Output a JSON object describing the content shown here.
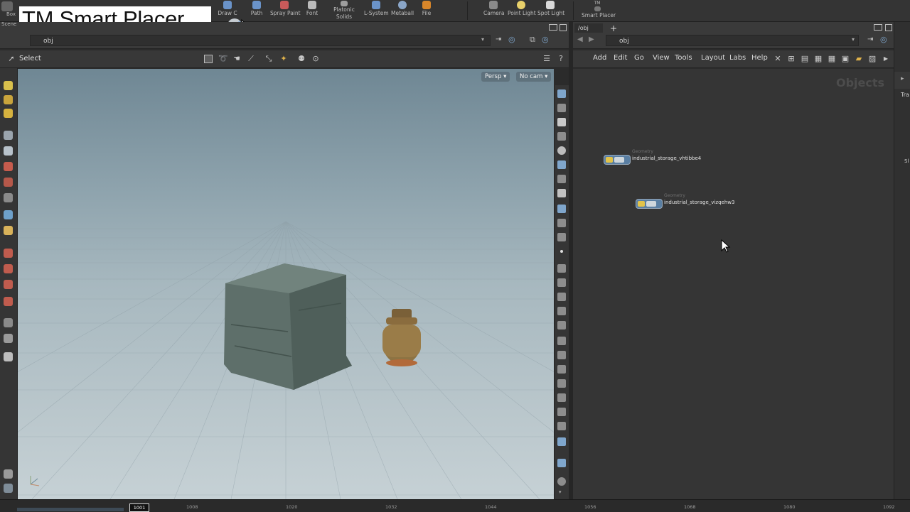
{
  "overlay_title": "TM Smart Placer",
  "shelf": {
    "left_cut": [
      "Box",
      "Scene"
    ],
    "tools": [
      {
        "label": "Draw Curve",
        "display": "Draw C",
        "icon": "draw-curve-icon"
      },
      {
        "label": "Path",
        "icon": "path-icon"
      },
      {
        "label": "Spray Paint",
        "icon": "spray-paint-icon"
      },
      {
        "label": "Font",
        "icon": "font-icon"
      },
      {
        "label": "Platonic Solids",
        "line1": "Platonic",
        "line2": "Solids",
        "icon": "platonic-solids-icon"
      },
      {
        "label": "L-System",
        "icon": "l-system-icon"
      },
      {
        "label": "Metaball",
        "icon": "metaball-icon"
      },
      {
        "label": "File",
        "icon": "file-icon"
      },
      {
        "label": "Camera",
        "icon": "camera-icon"
      },
      {
        "label": "Point Light",
        "icon": "point-light-icon"
      },
      {
        "label": "Spot Light",
        "icon": "spot-light-icon"
      },
      {
        "label": "Smart Placer",
        "top": "TM",
        "icon": "smart-placer-icon"
      }
    ]
  },
  "left_pane": {
    "path": "obj",
    "select_label": "Select",
    "persp_label": "Persp",
    "cam_label": "No cam"
  },
  "right_pane": {
    "tab": "/obj",
    "path": "obj",
    "menu": [
      "Add",
      "Edit",
      "Go",
      "View",
      "Tools",
      "Layout",
      "Labs",
      "Help"
    ],
    "context_label": "Objects",
    "nodes": [
      {
        "type": "Geometry",
        "name": "industrial_storage_vhtibbe4"
      },
      {
        "type": "Geometry",
        "name": "industrial_storage_vizqehw3"
      }
    ]
  },
  "far_right": {
    "label_tr": "Tra",
    "label_sl": "Sl"
  },
  "timeline": {
    "current_frame": "1001",
    "ticks": [
      "1008",
      "1020",
      "1032",
      "1044",
      "1056",
      "1068",
      "1080",
      "1092"
    ]
  },
  "colors": {
    "accent_blue": "#5a7fa3",
    "node_yellow": "#e2c34a",
    "title_bg": "#ffffff"
  }
}
